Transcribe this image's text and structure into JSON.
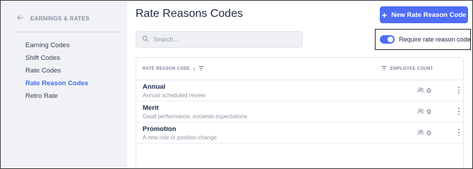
{
  "sidebar": {
    "back_label": "EARNINGS & RATES",
    "items": [
      {
        "label": "Earning Codes",
        "active": false
      },
      {
        "label": "Shift Codes",
        "active": false
      },
      {
        "label": "Rate Codes",
        "active": false
      },
      {
        "label": "Rate Reason Codes",
        "active": true
      },
      {
        "label": "Retro Rate",
        "active": false
      }
    ]
  },
  "header": {
    "title": "Rate Reasons Codes",
    "new_button_label": "New Rate Reason Code"
  },
  "search": {
    "placeholder": "Search...",
    "value": ""
  },
  "toggle": {
    "label": "Require rate reason code",
    "on": true
  },
  "table": {
    "columns": {
      "code": "RATE REASON CODE",
      "count": "EMPLOYEE COUNT"
    },
    "rows": [
      {
        "name": "Annual",
        "description": "Annual scheduled review",
        "count": "0"
      },
      {
        "name": "Merit",
        "description": "Good performance, exceeds expectations",
        "count": "0"
      },
      {
        "name": "Promotion",
        "description": "A new role or position change",
        "count": "0"
      }
    ]
  },
  "icons": {
    "back": "arrow-left-icon",
    "plus": "plus-icon",
    "search": "search-icon",
    "sort": "sort-ascending-icon",
    "filter": "filter-icon",
    "people": "users-icon",
    "menu": "more-vertical-icon"
  },
  "colors": {
    "accent": "#4f6ef7",
    "active_nav": "#3f6ff1",
    "sidebar_bg": "#f1f2f6"
  }
}
